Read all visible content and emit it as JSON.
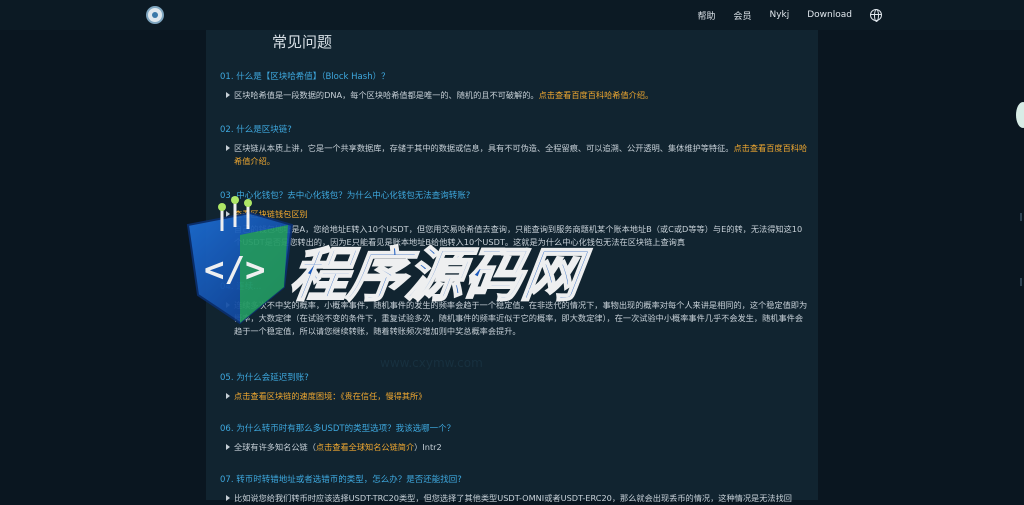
{
  "header": {
    "brand_name": "",
    "nav": [
      "帮助",
      "会员",
      "Nykj",
      "Download"
    ]
  },
  "page_title": "常见问题",
  "faqs": [
    {
      "question": "01. 什么是【区块哈希值】（Block Hash）？",
      "answer_text": "区块哈希值是一段数据的DNA，每个区块哈希值都是唯一的、随机的且不可破解的。",
      "link_text": "点击查看百度百科哈希值介绍。"
    },
    {
      "question": "02. 什么是区块链?",
      "answer_text": "区块链从本质上讲，它是一个共享数据库，存储于其中的数据或信息，具有不可伪造、全程留痕、可以追溯、公开透明、集体维护等特征。",
      "link_text": "点击查看百度百科哈希值介绍。"
    },
    {
      "question": "03. 中心化钱包？去中心化钱包？为什么中心化钱包无法查询转账?",
      "answer_text": "查看区块链钱包区别",
      "extra": "自己的钱包地址是A，您给地址E转入10个USDT，但您用交易哈希值去查询，只能查询到服务商题机某个账本地址B（或C或D等等）与E的转，无法得知这10个USDT是否是您转出的，因为E只能看见是账本地址B给他转入10个USDT。这就是为什么中心化钱包无法在区块链上查询真"
    },
    {
      "question": "04. 连续...",
      "answer_text": "连续多次不中奖的概率，小概率事件，随机事件的发生的频率会趋于一个稳定值。在非迭代的情况下，事物出现的概率对每个人来讲是相同的，这个稳定值即为概率，大数定律（在试验不变的条件下，重复试验多次，随机事件的频率近似于它的概率，即大数定律），在一次试验中小概率事件几乎不会发生，随机事件会趋于一个稳定值，所以请您继续转账，随着转账频次增加则中奖总概率会提升。"
    },
    {
      "question": "05. 为什么会延迟到账?",
      "answer_text": "点击查看区块链的速度困境：《贵在信任，慢得其所》"
    },
    {
      "question": "06. 为什么转币时有那么多USDT的类型选项？我该选哪一个？",
      "answer_text": "全球有许多知名公链（",
      "link_text": "点击查看全球知名公链简介",
      "answer_tail": "）Intr2"
    },
    {
      "question": "07. 转币时转错地址或者选错币的类型，怎么办？是否还能找回?",
      "answer_text": "比如说您给我们转币时应该选择USDT-TRC20类型，但您选择了其他类型USDT-OMNI或者USDT-ERC20，那么就会出现丢币的情况，这种情况是无法找回"
    }
  ],
  "watermark": {
    "text": "程序源码网",
    "url_text": "www.cxymw.com"
  },
  "colors": {
    "bg": "#0a1620",
    "panel": "#112430",
    "question": "#3ea8de",
    "highlight": "#f0a830",
    "text": "#c7d0d7"
  }
}
